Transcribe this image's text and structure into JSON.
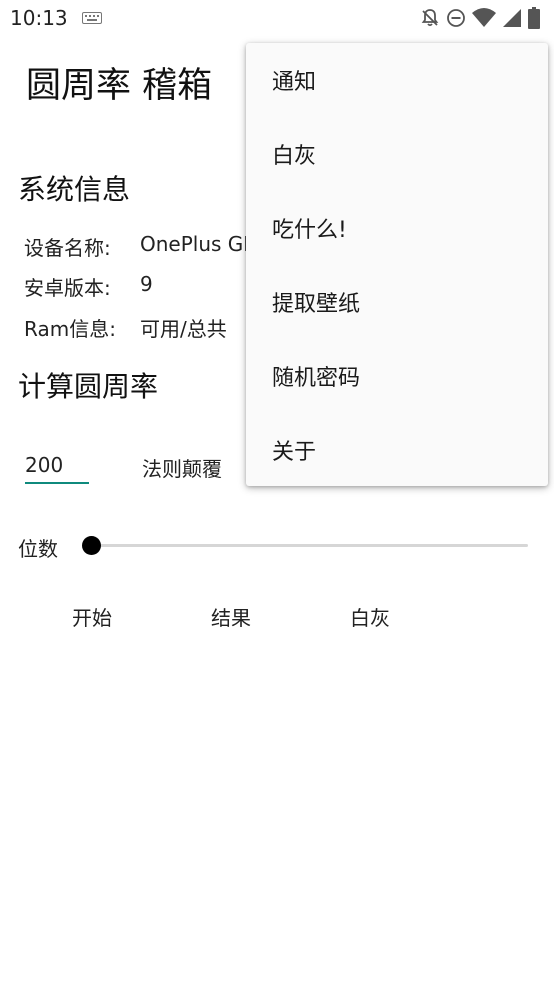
{
  "status_bar": {
    "time": "10:13",
    "icons": [
      "keyboard-icon",
      "notifications-off-icon",
      "do-not-disturb-icon",
      "wifi-icon",
      "cell-signal-icon",
      "battery-icon"
    ]
  },
  "app": {
    "title": "圆周率 稽箱"
  },
  "system_info": {
    "header": "系统信息",
    "rows": [
      {
        "label": "设备名称:",
        "value": "OnePlus GN"
      },
      {
        "label": "安卓版本:",
        "value": "9"
      },
      {
        "label": "Ram信息:",
        "value": "可用/总共"
      }
    ]
  },
  "calc": {
    "header": "计算圆周率",
    "digits_value": "200",
    "law_label": "法则颠覆",
    "slider_label": "位数",
    "slider_value": 0,
    "buttons": [
      "开始",
      "结果",
      "白灰"
    ]
  },
  "menu": {
    "items": [
      "通知",
      "白灰",
      "吃什么!",
      "提取壁纸",
      "随机密码",
      "关于"
    ]
  },
  "colors": {
    "accent": "#0f8a7d",
    "menu_bg": "#fafafa"
  }
}
